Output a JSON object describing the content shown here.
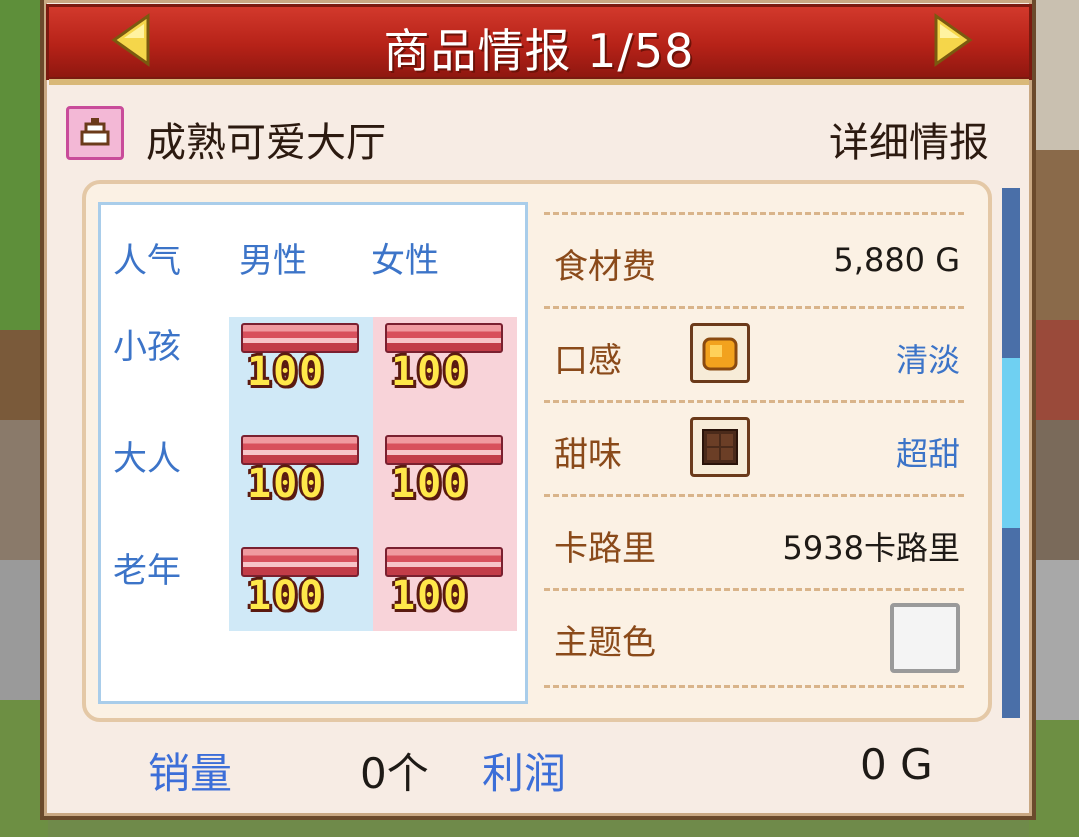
{
  "title": "商品情报 1/58",
  "product": {
    "name": "成熟可爱大厅",
    "detail_label": "详细情报"
  },
  "popularity": {
    "header": "人气",
    "col_male": "男性",
    "col_female": "女性",
    "rows": [
      {
        "label": "小孩",
        "male": "100",
        "female": "100"
      },
      {
        "label": "大人",
        "male": "100",
        "female": "100"
      },
      {
        "label": "老年",
        "male": "100",
        "female": "100"
      }
    ]
  },
  "info": {
    "cost_label": "食材费",
    "cost_value": "5,880 G",
    "texture_label": "口感",
    "texture_value": "清淡",
    "sweet_label": "甜味",
    "sweet_value": "超甜",
    "calorie_label": "卡路里",
    "calorie_value": "5938卡路里",
    "color_label": "主题色",
    "theme_color": "#f4f4f4"
  },
  "footer": {
    "sales_label": "销量",
    "sales_value": "0个",
    "profit_label": "利润",
    "profit_value": "0 G"
  },
  "icons": {
    "category": "cake-slice-icon",
    "texture": "cheese-block-icon",
    "sweet": "chocolate-bar-icon"
  },
  "colors": {
    "title_bar": "#b62218",
    "label_blue": "#3c74c8",
    "label_brown": "#8a4a1a",
    "score_yellow": "#ffe84a"
  }
}
